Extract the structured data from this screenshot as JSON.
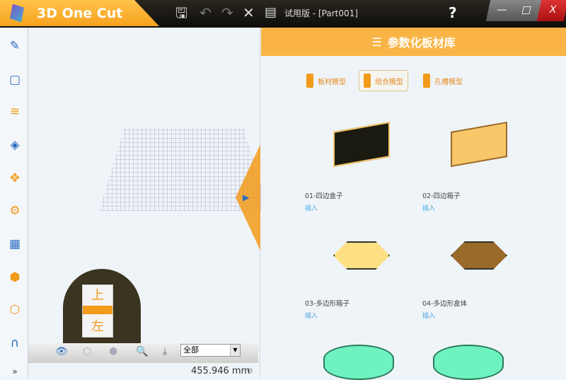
{
  "app": {
    "name": "3D One Cut",
    "doc_title": "试用版 - [Part001]"
  },
  "titlebar": {
    "help": "?",
    "min": "—",
    "max": "□",
    "close": "X"
  },
  "viewcube": {
    "top_label": "上",
    "front_label": "左"
  },
  "view_toolbar": {
    "filter_value": "全部"
  },
  "status": {
    "distance": "455.946 mm"
  },
  "panel": {
    "title": "参数化板材库",
    "tabs": [
      {
        "label": "板材模型"
      },
      {
        "label": "组合模型"
      },
      {
        "label": "孔槽模型"
      }
    ],
    "items": [
      {
        "name": "01-四边盒子",
        "action": "插入"
      },
      {
        "name": "02-四边箱子",
        "action": "插入"
      },
      {
        "name": "03-多边形箱子",
        "action": "插入"
      },
      {
        "name": "04-多边形盒体",
        "action": "插入"
      }
    ]
  }
}
